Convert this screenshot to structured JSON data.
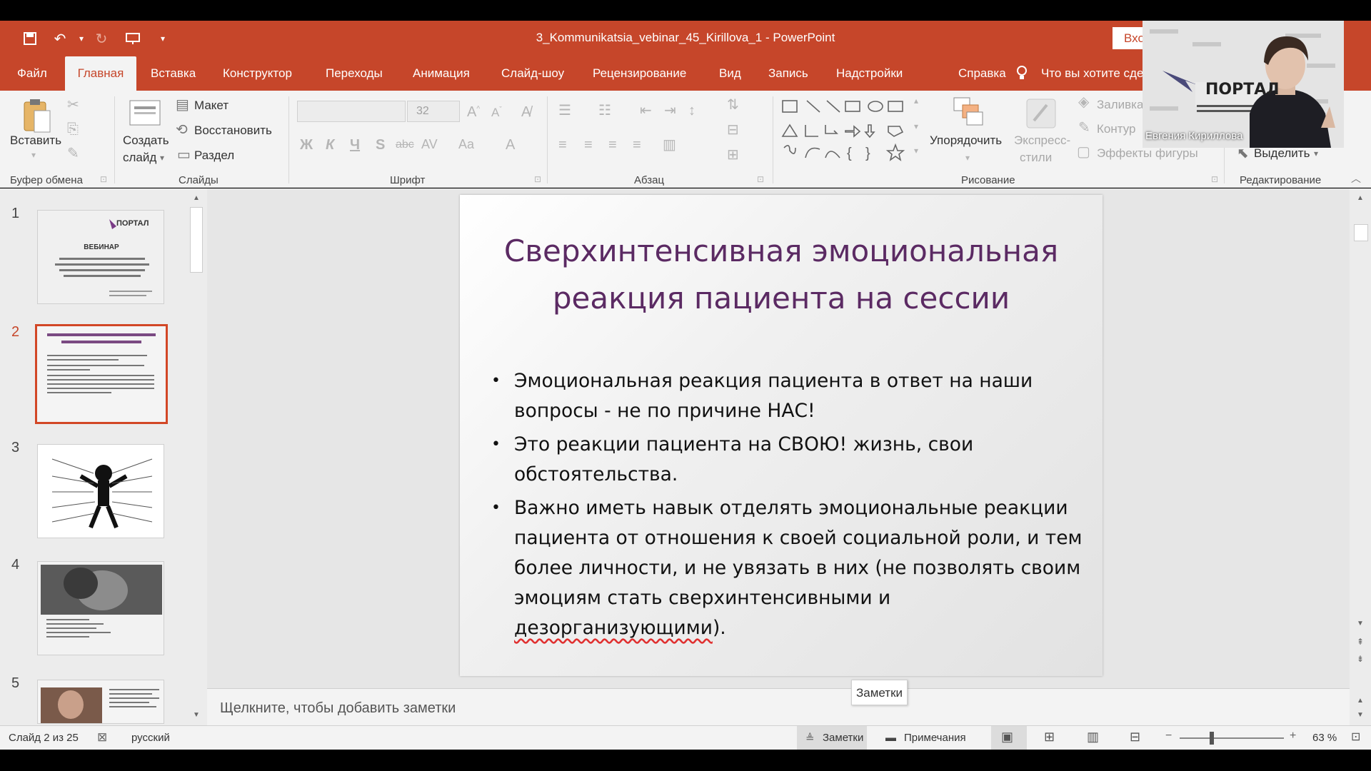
{
  "window": {
    "doc_title": "3_Kommunikatsia_vebinar_45_Kirillova_1  -  PowerPoint",
    "signin_label": "Вхо"
  },
  "tabs": [
    "Файл",
    "Главная",
    "Вставка",
    "Конструктор",
    "Переходы",
    "Анимация",
    "Слайд-шоу",
    "Рецензирование",
    "Вид",
    "Запись",
    "Надстройки",
    "Справка"
  ],
  "active_tab": "Главная",
  "tellme": "Что вы хотите сде",
  "ribbon": {
    "clipboard": {
      "paste": "Вставить",
      "group": "Буфер обмена"
    },
    "slides": {
      "new_slide_1": "Создать",
      "new_slide_2": "слайд",
      "layout": "Макет",
      "reset": "Восстановить",
      "section": "Раздел",
      "group": "Слайды"
    },
    "font": {
      "size": "32",
      "bold": "Ж",
      "italic": "К",
      "underline": "Ч",
      "shadow": "S",
      "strike": "abc",
      "spacing": "AV",
      "case": "Aa",
      "color": "A",
      "group": "Шрифт"
    },
    "paragraph": {
      "group": "Абзац"
    },
    "drawing": {
      "arrange": "Упорядочить",
      "quick_styles_1": "Экспресс-",
      "quick_styles_2": "стили",
      "fill": "Заливка",
      "outline": "Контур",
      "effects": "Эффекты фигуры",
      "group": "Рисование"
    },
    "editing": {
      "select": "Выделить",
      "group": "Редактирование"
    }
  },
  "thumbnails": {
    "numbers": [
      "1",
      "2",
      "3",
      "4",
      "5"
    ],
    "slide1_title": "ВЕБИНАР",
    "slide1_logo": "ПОРТАЛ"
  },
  "slide": {
    "title_line1": "Сверхинтенсивная эмоциональная",
    "title_line2": "реакция пациента на сессии",
    "bullets": [
      "Эмоциональная реакция пациента в ответ на наши вопросы - не по причине НАС!",
      "Это реакции пациента на СВОЮ! жизнь, свои обстоятельства."
    ],
    "bullet3_text": "Важно иметь навык отделять эмоциональные реакции пациента от отношения к своей социальной роли, и тем более личности, и не увязать в них (не позволять своим эмоциям стать сверхинтенсивными и ",
    "bullet3_underlined": "дезорганизующими",
    "bullet3_end": ")."
  },
  "notes": {
    "placeholder": "Щелкните, чтобы добавить заметки",
    "tooltip": "Заметки"
  },
  "status": {
    "slide_counter": "Слайд 2 из 25",
    "language": "русский",
    "notes_button": "Заметки",
    "comments_button": "Примечания",
    "zoom": "63 %"
  },
  "video": {
    "name": "Евгения Кириллова",
    "logo": "ПОРТАЛ"
  }
}
